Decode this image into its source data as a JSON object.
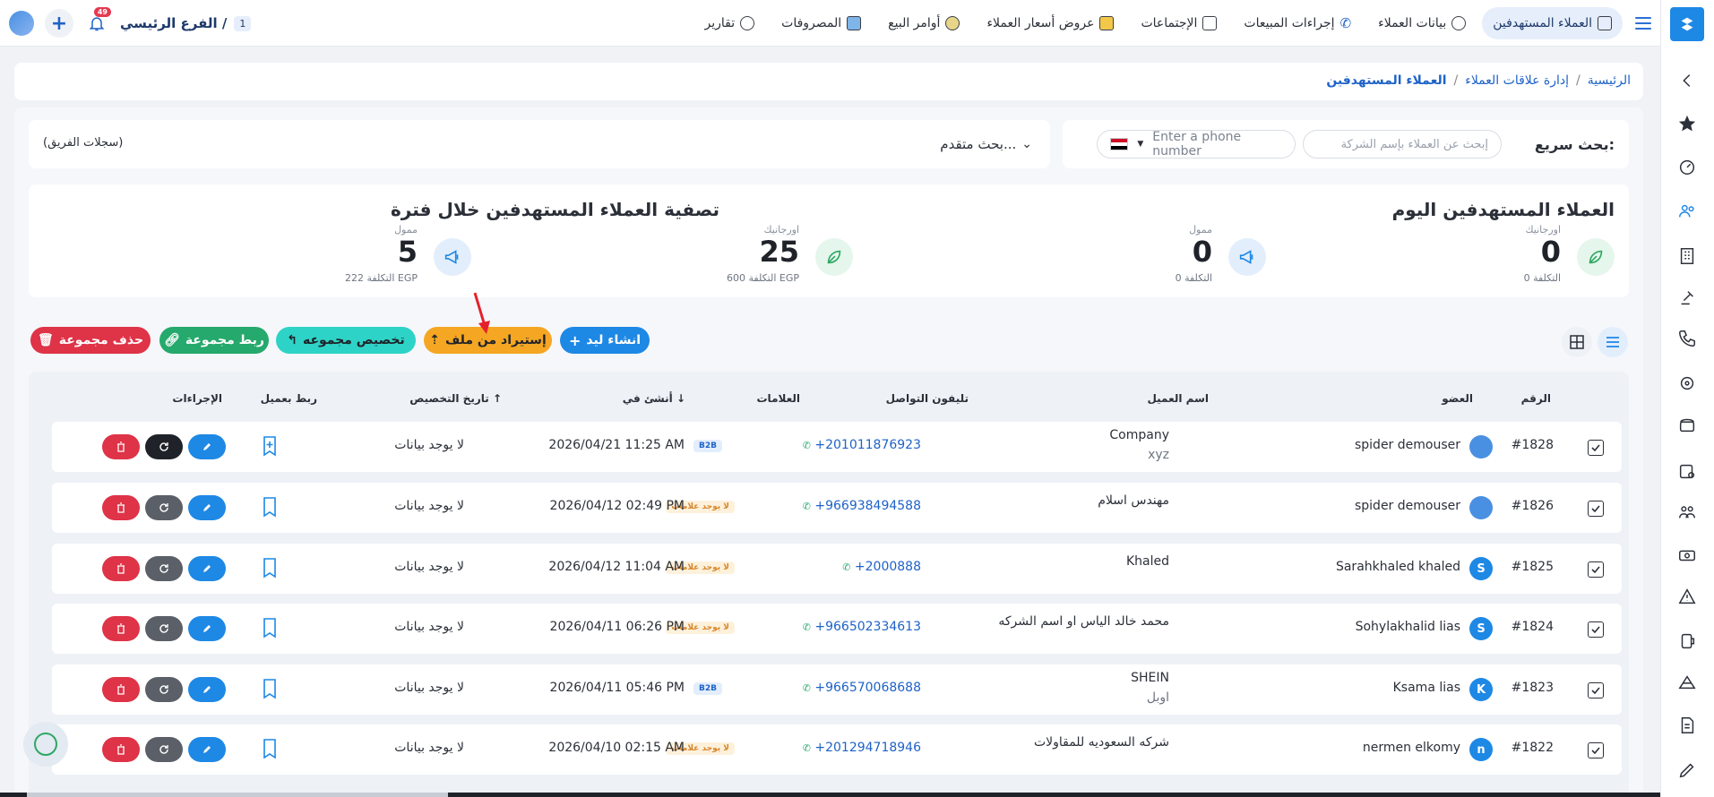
{
  "topnav": {
    "items": [
      {
        "label": "العملاء المستهدفين",
        "active": true,
        "icon": "targeted-customers-icon"
      },
      {
        "label": "بيانات العملاء",
        "icon": "customer-data-icon"
      },
      {
        "label": "إجراءات المبيعات",
        "icon": "phone-icon"
      },
      {
        "label": "الإجتماعات",
        "icon": "meetings-icon"
      },
      {
        "label": "عروض أسعار العملاء",
        "icon": "quotes-icon"
      },
      {
        "label": "أوامر البيع",
        "icon": "sales-orders-icon"
      },
      {
        "label": "المصروفات",
        "icon": "expenses-icon"
      },
      {
        "label": "تقارير",
        "icon": "reports-icon"
      }
    ],
    "branch": "الفرع الرئيسي /",
    "branch_num": "1",
    "bell_badge": "49"
  },
  "breadcrumb": {
    "home": "الرئيسية",
    "section": "إدارة علاقات العملاء",
    "current": "العملاء المستهدفين",
    "sep": "/"
  },
  "search": {
    "label": "بحث سريع:",
    "company_placeholder": "إبحث عن العملاء بإسم الشركة",
    "phone_placeholder": "Enter a phone number",
    "advanced": "بحث متقدم...",
    "team_records": "(سجلات الفريق)"
  },
  "stats": {
    "today_title": "العملاء المستهدفين اليوم",
    "period_title": "تصفية العملاء المستهدفين خلال فترة",
    "blocks": [
      {
        "label": "اورجانيك",
        "value": "0",
        "cost": "التكلفة 0"
      },
      {
        "label": "ممول",
        "value": "0",
        "cost": "التكلفة 0"
      },
      {
        "label": "اورجانيك",
        "value": "25",
        "cost": "التكلفة 600 EGP"
      },
      {
        "label": "ممول",
        "value": "5",
        "cost": "التكلفة 222 EGP"
      }
    ]
  },
  "actions": {
    "create_lead": "انشاء ليد",
    "import_file": "إستيراد من ملف",
    "assign_group": "تخصيص مجموعه",
    "link_group": "ربط مجموعة",
    "delete_group": "حذف مجموعة"
  },
  "table": {
    "headers": {
      "num": "الرقم",
      "member": "العضو",
      "client": "اسم العميل",
      "phone": "تليفون التواصل",
      "tags": "العلامات",
      "created": "أنشئ في",
      "assigned": "تاريخ التخصيص",
      "link": "ربط بعميل",
      "actions": "الإجراءات"
    },
    "rows": [
      {
        "num": "#1828",
        "member": "spider demouser",
        "avatar": "",
        "avatar_color": "#4a90e2",
        "client": "Company",
        "client2": "xyz",
        "phone": "+201011876923",
        "tag": "B2B",
        "tag_type": "b2b",
        "created": "2026/04/21 11:25 AM",
        "assigned": "لا يوجد بيانات"
      },
      {
        "num": "#1826",
        "member": "spider demouser",
        "avatar": "",
        "avatar_color": "#4a90e2",
        "client": "مهندس اسلام",
        "client2": "",
        "phone": "+966938494588",
        "tag": "لا يوجد علامات",
        "tag_type": "none",
        "created": "2026/04/12 02:49 PM",
        "assigned": "لا يوجد بيانات"
      },
      {
        "num": "#1825",
        "member": "Sarahkhaled khaled",
        "avatar": "S",
        "avatar_color": "#1e88e5",
        "client": "Khaled",
        "client2": "",
        "phone": "+2000888",
        "tag": "لا يوجد علامات",
        "tag_type": "none",
        "created": "2026/04/12 11:04 AM",
        "assigned": "لا يوجد بيانات"
      },
      {
        "num": "#1824",
        "member": "Sohylakhalid lias",
        "avatar": "S",
        "avatar_color": "#1e88e5",
        "client": "محمد خالد الياس او اسم الشركه",
        "client2": "",
        "phone": "+966502334613",
        "tag": "لا يوجد علامات",
        "tag_type": "none",
        "created": "2026/04/11 06:26 PM",
        "assigned": "لا يوجد بيانات"
      },
      {
        "num": "#1823",
        "member": "Ksama lias",
        "avatar": "K",
        "avatar_color": "#1e88e5",
        "client": "SHEIN",
        "client2": "اوبل",
        "phone": "+966570068688",
        "tag": "B2B",
        "tag_type": "b2b",
        "created": "2026/04/11 05:46 PM",
        "assigned": "لا يوجد بيانات"
      },
      {
        "num": "#1822",
        "member": "nermen elkomy",
        "avatar": "n",
        "avatar_color": "#1e88e5",
        "client": "شركه السعوديه للمقاولات",
        "client2": "",
        "phone": "+201294718946",
        "tag": "لا يوجد علامات",
        "tag_type": "none",
        "created": "2026/04/10 02:15 AM",
        "assigned": "لا يوجد بيانات"
      }
    ]
  },
  "colors": {
    "primary": "#1e88e5",
    "orange": "#f5a623",
    "teal": "#2ed3c7",
    "green": "#26a96c",
    "red": "#df3347"
  }
}
